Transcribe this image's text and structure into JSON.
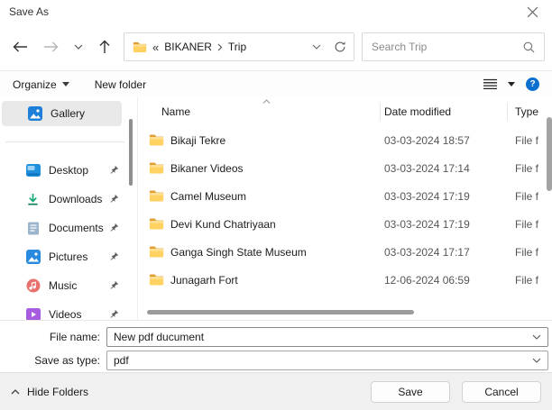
{
  "window": {
    "title": "Save As"
  },
  "nav": {
    "breadcrumb": {
      "overflow": "«",
      "root": "BIKANER",
      "current": "Trip"
    },
    "search_placeholder": "Search Trip"
  },
  "toolbar": {
    "organize": "Organize",
    "new_folder": "New folder"
  },
  "sidebar": {
    "gallery_label": "Gallery",
    "items": [
      {
        "label": "Desktop",
        "icon": "desktop-icon"
      },
      {
        "label": "Downloads",
        "icon": "downloads-icon"
      },
      {
        "label": "Documents",
        "icon": "documents-icon"
      },
      {
        "label": "Pictures",
        "icon": "pictures-icon"
      },
      {
        "label": "Music",
        "icon": "music-icon"
      },
      {
        "label": "Videos",
        "icon": "videos-icon"
      }
    ]
  },
  "list": {
    "columns": {
      "name": "Name",
      "date": "Date modified",
      "type": "Type"
    },
    "rows": [
      {
        "name": "Bikaji Tekre",
        "date": "03-03-2024 18:57",
        "type": "File f"
      },
      {
        "name": "Bikaner Videos",
        "date": "03-03-2024 17:14",
        "type": "File f"
      },
      {
        "name": "Camel Museum",
        "date": "03-03-2024 17:19",
        "type": "File f"
      },
      {
        "name": "Devi Kund Chatriyaan",
        "date": "03-03-2024 17:19",
        "type": "File f"
      },
      {
        "name": "Ganga Singh State Museum",
        "date": "03-03-2024 17:17",
        "type": "File f"
      },
      {
        "name": "Junagarh Fort",
        "date": "12-06-2024 06:59",
        "type": "File f"
      }
    ]
  },
  "form": {
    "file_name_label": "File name:",
    "file_name_value": "New pdf ducument",
    "save_type_label": "Save as type:",
    "save_type_value": "pdf"
  },
  "footer": {
    "hide_folders": "Hide Folders",
    "save": "Save",
    "cancel": "Cancel"
  },
  "colors": {
    "accent": "#0b6fd0",
    "folder_front": "#ffd262",
    "folder_back": "#e09e33",
    "selected_bg": "#e9e9e9",
    "footer_bg": "#f0f0f0"
  }
}
